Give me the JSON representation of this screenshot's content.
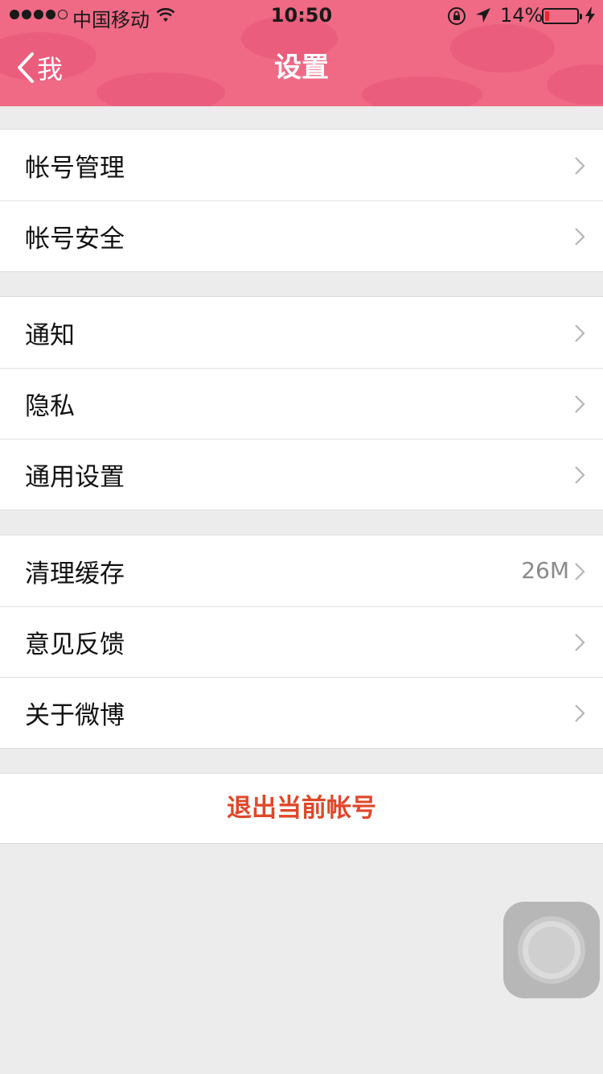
{
  "status_bar": {
    "carrier": "中国移动",
    "time": "10:50",
    "battery_percent": "14%",
    "battery_level": 0.14,
    "signal_bars_filled": 4,
    "signal_bars_total": 5
  },
  "nav": {
    "back_label": "我",
    "title": "设置"
  },
  "groups": [
    {
      "items": [
        {
          "label": "帐号管理"
        },
        {
          "label": "帐号安全"
        }
      ]
    },
    {
      "items": [
        {
          "label": "通知"
        },
        {
          "label": "隐私"
        },
        {
          "label": "通用设置"
        }
      ]
    },
    {
      "items": [
        {
          "label": "清理缓存",
          "value": "26M"
        },
        {
          "label": "意见反馈"
        },
        {
          "label": "关于微博"
        }
      ]
    }
  ],
  "logout": {
    "label": "退出当前帐号"
  },
  "colors": {
    "header": "#f06a86",
    "logout_text": "#e0472a",
    "battery_low": "#e8282a"
  },
  "icons": [
    "back-chevron-icon",
    "chevron-right-icon",
    "wifi-icon",
    "rotation-lock-icon",
    "location-arrow-icon",
    "battery-icon",
    "charging-bolt-icon",
    "assistive-touch-icon"
  ]
}
